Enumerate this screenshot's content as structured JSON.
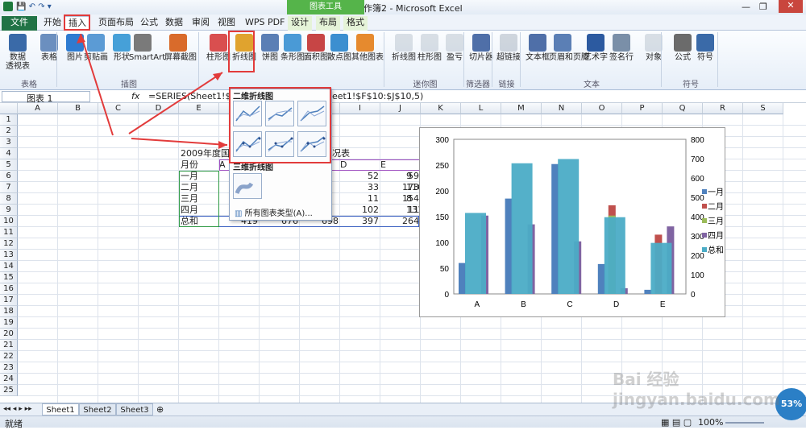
{
  "window": {
    "title": "工作簿2 - Microsoft Excel",
    "context_tab_group": "图表工具"
  },
  "tabs": [
    "文件",
    "开始",
    "插入",
    "页面布局",
    "公式",
    "数据",
    "审阅",
    "视图",
    "WPS PDF",
    "设计",
    "布局",
    "格式"
  ],
  "ribbon": {
    "groups": [
      {
        "label": "表格",
        "items": [
          "数据\n透视表",
          "表格"
        ]
      },
      {
        "label": "插图",
        "items": [
          "图片",
          "剪贴画",
          "形状",
          "SmartArt",
          "屏幕截图"
        ]
      },
      {
        "label": "",
        "items": [
          "柱形图",
          "折线图",
          "饼图",
          "条形图",
          "面积图",
          "散点图",
          "其他图表"
        ]
      },
      {
        "label": "迷你图",
        "items": [
          "折线图",
          "柱形图",
          "盈亏"
        ]
      },
      {
        "label": "筛选器",
        "items": [
          "切片器"
        ]
      },
      {
        "label": "链接",
        "items": [
          "超链接"
        ]
      },
      {
        "label": "文本",
        "items": [
          "文本框",
          "页眉和页脚",
          "艺术字",
          "签名行",
          "对象"
        ]
      },
      {
        "label": "符号",
        "items": [
          "公式",
          "符号"
        ]
      }
    ]
  },
  "formula_bar": {
    "name_box": "图表 1",
    "fx": "fx",
    "formula_left": "=SERIES(Sheet1!$E",
    "formula_right": "eet1!$F$10:$J$10,5)"
  },
  "columns": [
    "A",
    "B",
    "C",
    "D",
    "E",
    "F",
    "G",
    "H",
    "I",
    "J",
    "K",
    "L",
    "M",
    "N",
    "O",
    "P",
    "Q",
    "R",
    "S"
  ],
  "rows": [
    "1",
    "2",
    "3",
    "4",
    "5",
    "6",
    "7",
    "8",
    "9",
    "10",
    "11",
    "12",
    "13",
    "14",
    "15",
    "16",
    "17",
    "18",
    "19",
    "20",
    "21",
    "22",
    "23",
    "24",
    "25"
  ],
  "sheet": {
    "title_left": "2009年度国",
    "title_right": "况表",
    "header_label": "月份",
    "header_cols": [
      "A",
      "",
      "",
      "D",
      "E"
    ],
    "row_labels": [
      "一月",
      "二月",
      "三月",
      "四月",
      "总和"
    ],
    "visible_values": [
      [
        "52",
        "59",
        "9"
      ],
      [
        "33",
        "173",
        "116"
      ],
      [
        "11",
        "154",
        "8"
      ],
      [
        "102",
        "11",
        "131"
      ],
      [
        "419",
        "676",
        "698",
        "397",
        "264"
      ]
    ]
  },
  "dropdown": {
    "section_2d": "二维折线图",
    "section_3d": "三维折线图",
    "all_types": "所有图表类型(A)..."
  },
  "chart_data": {
    "type": "bar",
    "categories": [
      "A",
      "B",
      "C",
      "D",
      "E"
    ],
    "series": [
      {
        "name": "一月",
        "values": [
          60,
          185,
          252,
          58,
          8
        ],
        "color": "#4f81bd"
      },
      {
        "name": "二月",
        "values": [
          0,
          0,
          0,
          172,
          115
        ],
        "color": "#c0504d"
      },
      {
        "name": "三月",
        "values": [
          0,
          0,
          0,
          152,
          0
        ],
        "color": "#9bbb59"
      },
      {
        "name": "四月",
        "values": [
          152,
          135,
          102,
          11,
          131
        ],
        "color": "#8064a2"
      },
      {
        "name": "总和",
        "values": [
          419,
          676,
          698,
          397,
          264
        ],
        "color": "#4bacc6",
        "axis": "secondary"
      }
    ],
    "y_left_ticks": [
      "0",
      "50",
      "100",
      "150",
      "200",
      "250",
      "300"
    ],
    "y_right_ticks": [
      "0",
      "100",
      "200",
      "300",
      "400",
      "500",
      "600",
      "700",
      "800"
    ],
    "ylim": [
      0,
      300
    ],
    "y2lim": [
      0,
      800
    ]
  },
  "sheet_tabs": [
    "Sheet1",
    "Sheet2",
    "Sheet3"
  ],
  "status": {
    "ready": "就绪",
    "zoom": "100%",
    "badge": "53%"
  },
  "watermark": "Bai 经验 jingyan.baidu.com"
}
